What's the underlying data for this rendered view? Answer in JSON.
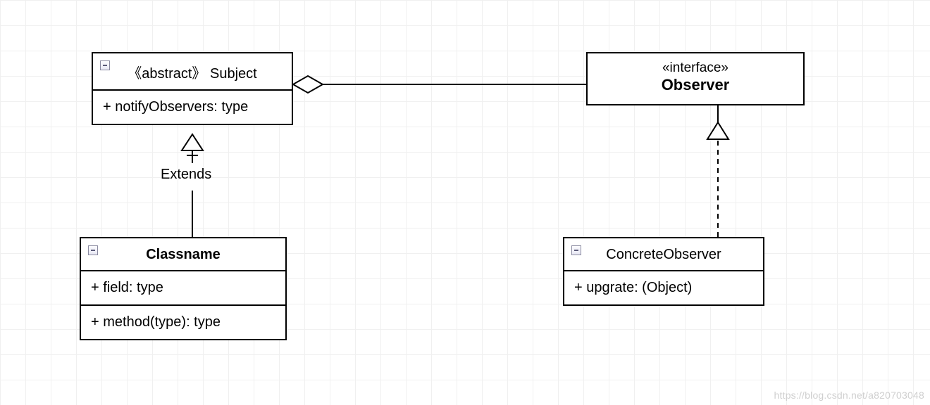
{
  "boxes": {
    "subject": {
      "stereotype": "《abstract》",
      "name": "Subject",
      "members": [
        "+ notifyObservers: type"
      ]
    },
    "classname": {
      "name": "Classname",
      "fields": [
        "+ field: type"
      ],
      "methods": [
        "+ method(type): type"
      ]
    },
    "observer": {
      "stereotype": "«interface»",
      "name": "Observer"
    },
    "concrete": {
      "name": "ConcreteObserver",
      "members": [
        "+ upgrate: (Object)"
      ]
    }
  },
  "labels": {
    "extends": "Extends"
  },
  "watermark": "https://blog.csdn.net/a820703048"
}
